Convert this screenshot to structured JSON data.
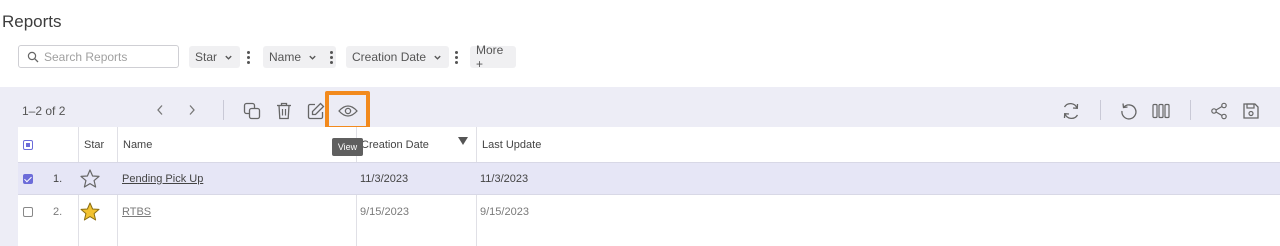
{
  "page": {
    "title": "Reports"
  },
  "filters": {
    "search_placeholder": "Search Reports",
    "chips": [
      "Star",
      "Name",
      "Creation Date",
      "More +"
    ]
  },
  "toolbar": {
    "count": "1–2 of 2",
    "tooltip": "View"
  },
  "table": {
    "columns": [
      "Star",
      "Name",
      "Creation Date",
      "Last Update"
    ],
    "rows": [
      {
        "index": "1.",
        "selected": true,
        "starred": false,
        "name": "Pending Pick Up",
        "creation_date": "11/3/2023",
        "last_update": "11/3/2023"
      },
      {
        "index": "2.",
        "selected": false,
        "starred": true,
        "name": "RTBS",
        "creation_date": "9/15/2023",
        "last_update": "9/15/2023"
      }
    ]
  },
  "colors": {
    "accent": "#6c6cd9",
    "highlight": "#f28a1d",
    "panel_bg": "#ededf6",
    "selected_row": "#e6e6f6",
    "star_fill": "#f2c230"
  }
}
